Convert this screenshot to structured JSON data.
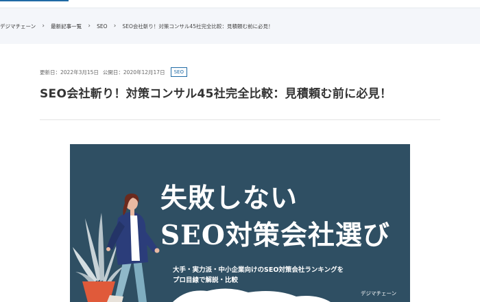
{
  "breadcrumb": {
    "items": [
      "デジマチェーン",
      "最新記事一覧",
      "SEO"
    ],
    "current": "SEO会社斬り！対策コンサル45社完全比較：見積頼む前に必見！",
    "separator_icon": "chevron-right-icon"
  },
  "article": {
    "updated_label": "更新日：2022年3月15日",
    "published_label": "公開日：2020年12月17日",
    "category_tag": "SEO",
    "title": "SEO会社斬り！対策コンサル45社完全比較：見積頼む前に必見！"
  },
  "hero": {
    "headline_line1": "失敗しない",
    "headline_line2": "SEO対策会社選び",
    "subtitle_line1": "大手・実力派・中小企業向けのSEO対策会社ランキングを",
    "subtitle_line2": "プロ目線で解説・比較",
    "brand": "デジマチェーン"
  },
  "colors": {
    "accent": "#1f6aa5",
    "hero_background": "#2f4f63",
    "breadcrumb_background": "#f4f6fa"
  }
}
